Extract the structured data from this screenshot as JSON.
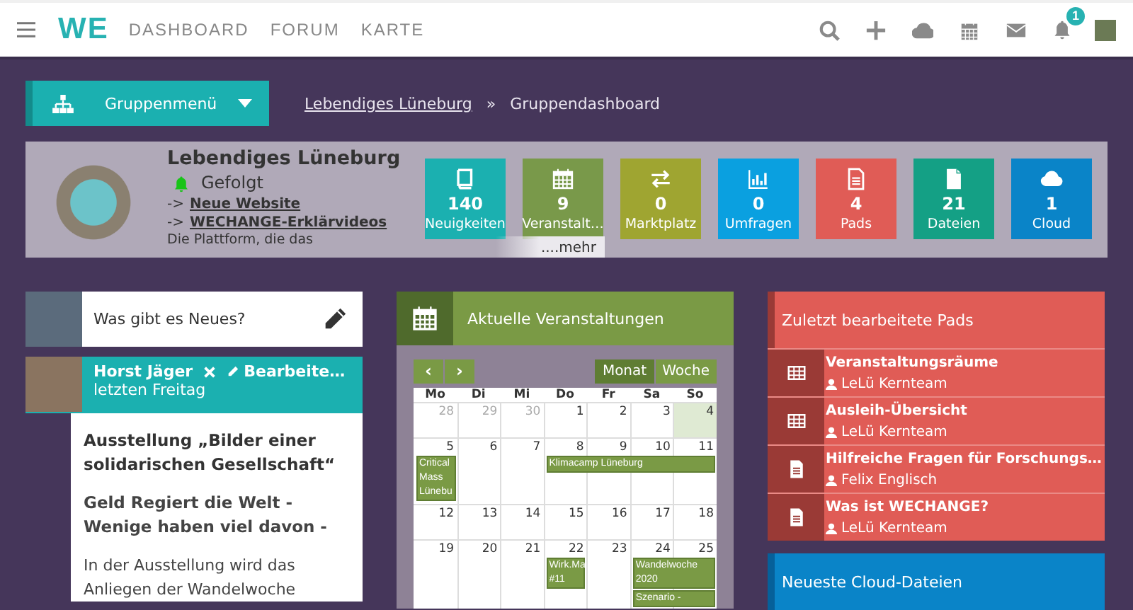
{
  "topbar": {
    "logo": "WE",
    "links": [
      "DASHBOARD",
      "FORUM",
      "KARTE"
    ],
    "notification_count": "1"
  },
  "breadcrumb": {
    "group_menu": "Gruppenmenü",
    "items": [
      "Lebendiges Lüneburg",
      "Gruppendashboard"
    ],
    "separator": "»"
  },
  "group": {
    "name": "Lebendiges Lüneburg",
    "follow_status": "Gefolgt",
    "links": [
      {
        "prefix": "->",
        "label": "Neue Website"
      },
      {
        "prefix": "->",
        "label": "WECHANGE-Erklärvideos"
      }
    ],
    "description": "Die Plattform, die das",
    "tiles": [
      {
        "kind": "book",
        "count": "140",
        "label": "Neuigkeiten",
        "color": "#1bb0b0"
      },
      {
        "kind": "calendar",
        "count": "9",
        "label": "Veranstalt…",
        "color": "#79994a"
      },
      {
        "kind": "exchange",
        "count": "0",
        "label": "Marktplatz",
        "color": "#9fa531"
      },
      {
        "kind": "chart",
        "count": "0",
        "label": "Umfragen",
        "color": "#0aa0e0"
      },
      {
        "kind": "pad",
        "count": "4",
        "label": "Pads",
        "color": "#e05c56"
      },
      {
        "kind": "file",
        "count": "21",
        "label": "Dateien",
        "color": "#14a085"
      },
      {
        "kind": "cloud",
        "count": "1",
        "label": "Cloud",
        "color": "#0a84c8"
      }
    ],
    "more": "....mehr"
  },
  "status": {
    "placeholder": "Was gibt es Neues?"
  },
  "post": {
    "author": "Horst Jäger",
    "edit": "Bearbeite…",
    "time": "letzten Freitag",
    "title": "Ausstellung „Bilder einer solidarischen Gesellschaft“",
    "subtitle": "Geld Regiert die Welt - Wenige haben viel davon -",
    "text": "In der Ausstellung wird das Anliegen der Wandelwoche"
  },
  "calendar": {
    "title": "Aktuelle Veranstaltungen",
    "prev": "‹",
    "next": "›",
    "views": [
      {
        "label": "Monat",
        "selected": true
      },
      {
        "label": "Woche",
        "selected": false
      }
    ],
    "weekdays": [
      "Mo",
      "Di",
      "Mi",
      "Do",
      "Fr",
      "Sa",
      "So"
    ],
    "weeks": [
      {
        "days": [
          {
            "day": "28",
            "other_month": true,
            "today": false
          },
          {
            "day": "29",
            "other_month": true,
            "today": false
          },
          {
            "day": "30",
            "other_month": true,
            "today": false
          },
          {
            "day": "1",
            "other_month": false,
            "today": false
          },
          {
            "day": "2",
            "other_month": false,
            "today": false
          },
          {
            "day": "3",
            "other_month": false,
            "today": false
          },
          {
            "day": "4",
            "other_month": false,
            "today": true
          }
        ]
      },
      {
        "days": [
          {
            "day": "5",
            "other_month": false,
            "today": false,
            "events": [
              {
                "label": "Critical Mass Lünebu",
                "spans_to_week_end": false
              }
            ]
          },
          {
            "day": "6",
            "other_month": false,
            "today": false
          },
          {
            "day": "7",
            "other_month": false,
            "today": false
          },
          {
            "day": "8",
            "other_month": false,
            "today": false,
            "events": [
              {
                "label": "Klimacamp Lüneburg",
                "spans_to_week_end": true
              }
            ]
          },
          {
            "day": "9",
            "other_month": false,
            "today": false
          },
          {
            "day": "10",
            "other_month": false,
            "today": false
          },
          {
            "day": "11",
            "other_month": false,
            "today": false
          }
        ]
      },
      {
        "days": [
          {
            "day": "12",
            "other_month": false,
            "today": false
          },
          {
            "day": "13",
            "other_month": false,
            "today": false
          },
          {
            "day": "14",
            "other_month": false,
            "today": false
          },
          {
            "day": "15",
            "other_month": false,
            "today": false
          },
          {
            "day": "16",
            "other_month": false,
            "today": false
          },
          {
            "day": "17",
            "other_month": false,
            "today": false
          },
          {
            "day": "18",
            "other_month": false,
            "today": false
          }
        ]
      },
      {
        "days": [
          {
            "day": "19",
            "other_month": false,
            "today": false
          },
          {
            "day": "20",
            "other_month": false,
            "today": false
          },
          {
            "day": "21",
            "other_month": false,
            "today": false
          },
          {
            "day": "22",
            "other_month": false,
            "today": false,
            "events": [
              {
                "label": "Wirk.Ma #11",
                "spans_to_week_end": false
              }
            ]
          },
          {
            "day": "23",
            "other_month": false,
            "today": false
          },
          {
            "day": "24",
            "other_month": false,
            "today": false,
            "events": [
              {
                "label": "Wandelwoche 2020",
                "spans_to_week_end": true
              },
              {
                "label": "Szenario -",
                "spans_to_week_end": true
              }
            ]
          },
          {
            "day": "25",
            "other_month": false,
            "today": false
          }
        ]
      }
    ]
  },
  "pads": {
    "title": "Zuletzt bearbeitete Pads",
    "items": [
      {
        "kind": "table",
        "title": "Veranstaltungsräume",
        "author": "LeLü Kernteam"
      },
      {
        "kind": "table",
        "title": "Ausleih-Übersicht",
        "author": "LeLü Kernteam"
      },
      {
        "kind": "document",
        "title": "Hilfreiche Fragen für Forschungs…",
        "author": "Felix Englisch"
      },
      {
        "kind": "document",
        "title": "Was ist WECHANGE?",
        "author": "LeLü Kernteam"
      }
    ]
  },
  "cloud": {
    "title": "Neueste Cloud-Dateien"
  }
}
